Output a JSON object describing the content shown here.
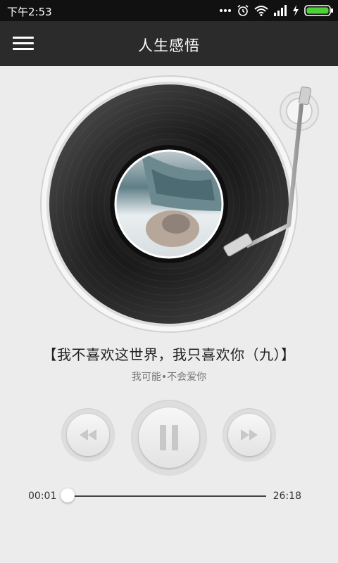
{
  "status_bar": {
    "time": "下午2:53",
    "icons": [
      "more-dots-icon",
      "alarm-icon",
      "wifi-icon",
      "signal-icon",
      "charging-icon",
      "battery-icon"
    ]
  },
  "app_bar": {
    "title": "人生感悟",
    "menu_icon": "hamburger-menu-icon"
  },
  "song": {
    "title": "【我不喜欢这世界，我只喜欢你（九）】",
    "artist": "我可能•不会爱你"
  },
  "controls": {
    "rewind_icon": "rewind-icon",
    "pause_icon": "pause-icon",
    "forward_icon": "fast-forward-icon"
  },
  "progress": {
    "current": "00:01",
    "total": "26:18",
    "fraction": 0.001
  },
  "colors": {
    "app_bar": "#2b2b2b",
    "background": "#ececec",
    "battery": "#4cd137"
  }
}
